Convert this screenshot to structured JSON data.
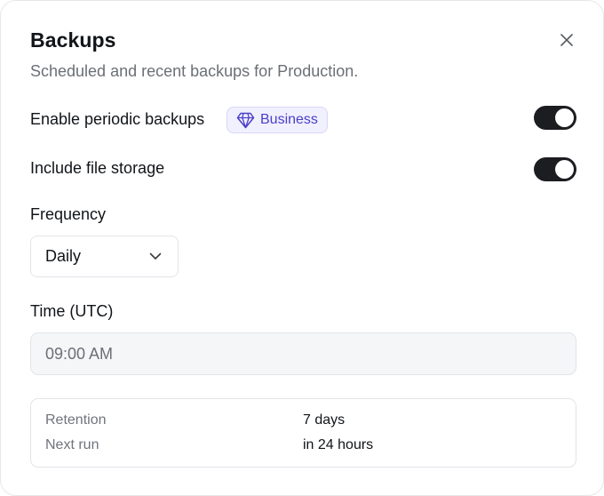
{
  "dialog": {
    "title": "Backups",
    "subtitle": "Scheduled and recent backups for Production.",
    "close_icon": "close-icon"
  },
  "settings": {
    "periodic": {
      "label": "Enable periodic backups",
      "badge": {
        "icon": "diamond-icon",
        "label": "Business",
        "color": "#4b40c9"
      },
      "enabled": true
    },
    "file_storage": {
      "label": "Include file storage",
      "enabled": true
    }
  },
  "frequency": {
    "label": "Frequency",
    "value": "Daily",
    "icon": "chevron-down-icon"
  },
  "time": {
    "label": "Time (UTC)",
    "placeholder": "09:00 AM"
  },
  "summary": {
    "rows": [
      {
        "key": "Retention",
        "value": "7 days"
      },
      {
        "key": "Next run",
        "value": "in 24 hours"
      }
    ]
  },
  "colors": {
    "toggle_on": "#1c1d20",
    "badge_bg": "#f1f0fe",
    "muted_text": "#6b6f76"
  }
}
